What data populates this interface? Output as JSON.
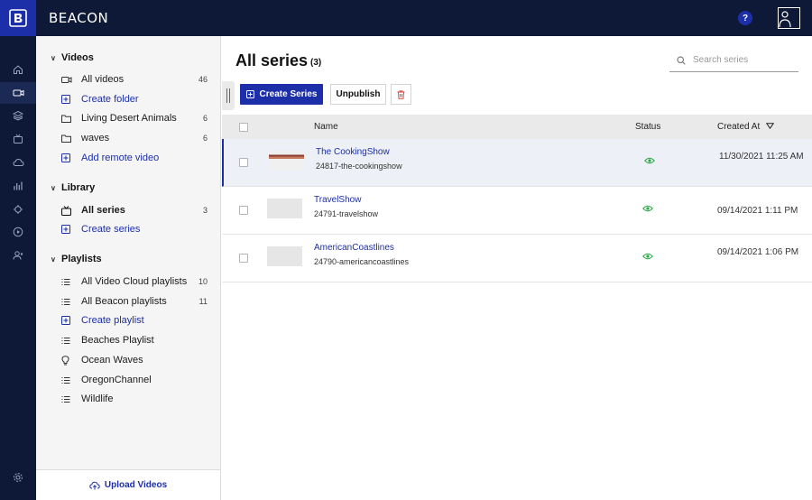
{
  "app": {
    "brand": "BEACON",
    "help_label": "?"
  },
  "colors": {
    "primary": "#1c2fa8",
    "topbar": "#0d1936",
    "status_published": "#28a745",
    "danger": "#e0382f"
  },
  "rail": [
    {
      "icon": "home-icon"
    },
    {
      "icon": "video-camera-icon",
      "active": true
    },
    {
      "icon": "layers-icon"
    },
    {
      "icon": "tv-icon"
    },
    {
      "icon": "cloud-icon"
    },
    {
      "icon": "analytics-icon"
    },
    {
      "icon": "plugin-icon"
    },
    {
      "icon": "play-circle-icon"
    },
    {
      "icon": "users-icon"
    },
    {
      "icon": "settings-gear-icon"
    }
  ],
  "sidebar": {
    "videos": {
      "heading": "Videos",
      "items": [
        {
          "label": "All videos",
          "count": "46",
          "icon": "video-camera-icon"
        },
        {
          "label": "Create folder",
          "icon": "plus-square-icon"
        },
        {
          "label": "Living Desert Animals",
          "count": "6",
          "icon": "folder-icon"
        },
        {
          "label": "waves",
          "count": "6",
          "icon": "folder-icon"
        },
        {
          "label": "Add remote video",
          "icon": "plus-square-icon"
        }
      ]
    },
    "library": {
      "heading": "Library",
      "items": [
        {
          "label": "All series",
          "count": "3",
          "icon": "tv-icon"
        },
        {
          "label": "Create series",
          "icon": "plus-square-icon"
        }
      ]
    },
    "playlists": {
      "heading": "Playlists",
      "items": [
        {
          "label": "All Video Cloud playlists",
          "count": "10",
          "icon": "list-icon"
        },
        {
          "label": "All Beacon playlists",
          "count": "11",
          "icon": "list-icon"
        },
        {
          "label": "Create playlist",
          "icon": "plus-square-icon"
        },
        {
          "label": "Beaches Playlist",
          "icon": "list-icon"
        },
        {
          "label": "Ocean Waves",
          "icon": "bulb-icon"
        },
        {
          "label": "OregonChannel",
          "icon": "list-icon"
        },
        {
          "label": "Wildlife",
          "icon": "list-icon"
        }
      ]
    },
    "upload_label": "Upload Videos"
  },
  "main": {
    "title": "All series",
    "count": "(3)",
    "search_placeholder": "Search series",
    "create_button": "Create Series",
    "unpublish_button": "Unpublish",
    "columns": {
      "name": "Name",
      "status": "Status",
      "created": "Created At"
    },
    "rows": [
      {
        "name": "The CookingShow",
        "slug": "24817-the-cookingshow",
        "created": "11/30/2021 11:25 AM",
        "status": "published"
      },
      {
        "name": "TravelShow",
        "slug": "24791-travelshow",
        "created": "09/14/2021 1:11 PM",
        "status": "published"
      },
      {
        "name": "AmericanCoastlines",
        "slug": "24790-americancoastlines",
        "created": "09/14/2021 1:06 PM",
        "status": "published"
      }
    ]
  }
}
